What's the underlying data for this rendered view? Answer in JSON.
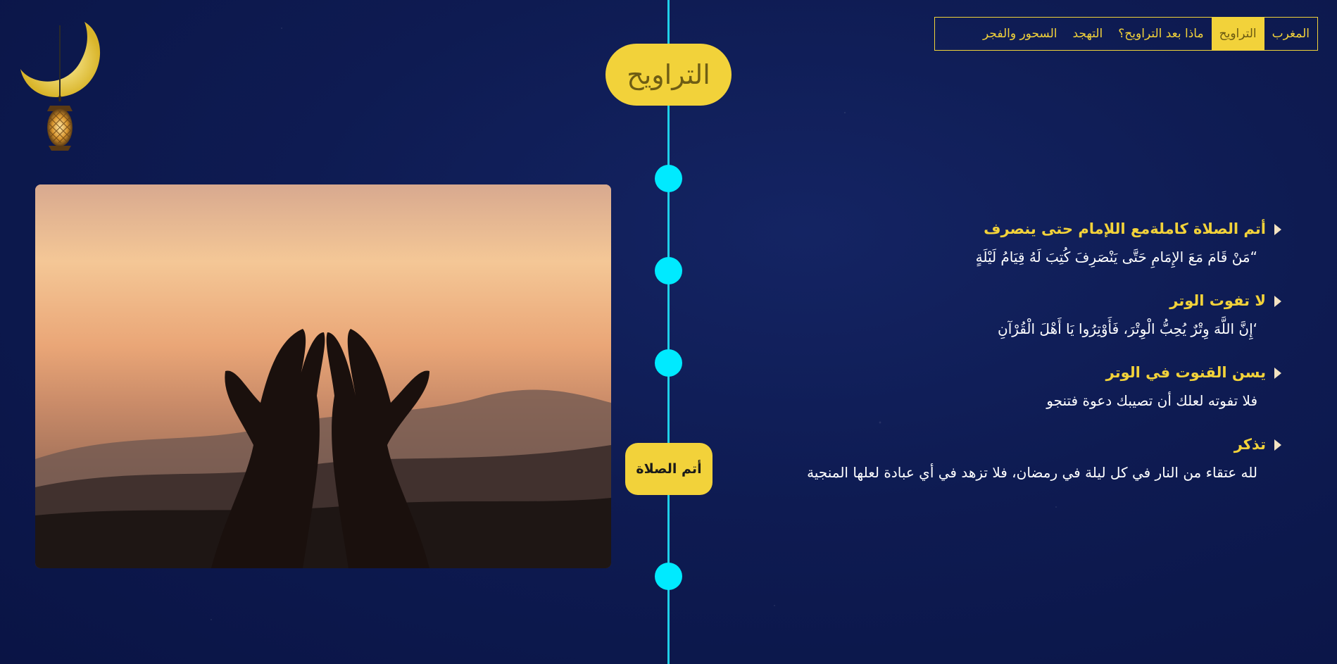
{
  "nav": {
    "items": [
      {
        "label": "المغرب",
        "active": false
      },
      {
        "label": "التراويح",
        "active": true
      },
      {
        "label": "ماذا بعد التراويح؟",
        "active": false
      },
      {
        "label": "التهجد",
        "active": false
      },
      {
        "label": "السحور والفجر",
        "active": false
      }
    ]
  },
  "timeline": {
    "title": "التراويح",
    "label": "أتم الصلاة"
  },
  "content": {
    "items": [
      {
        "title": "أتم الصلاة كاملةمع اللإمام حتى ينصرف",
        "body": "“مَنْ قَامَ مَعَ الإِمَامِ حَتَّى يَنْصَرِفَ كُتِبَ لَهُ قِيَامُ لَيْلَةٍ"
      },
      {
        "title": "لا تفوت الوتر",
        "body": "‘إِنَّ اللَّهَ وِتْرٌ يُحِبُّ الْوِتْرَ، فَأَوْتِرُوا يَا أَهْلَ الْقُرْآنِ"
      },
      {
        "title": "يسن القنوت في الوتر",
        "body": "فلا تفوته لعلك أن تصيبك دعوة فتنجو"
      },
      {
        "title": "تذكر",
        "body": "لله عتقاء من النار في كل ليلة في رمضان، فلا تزهد في أي عبادة لعلها المنجية"
      }
    ]
  },
  "icons": {
    "lantern": "crescent-lantern-icon",
    "marker": "triangle-marker-icon"
  },
  "colors": {
    "background": "#0e1b52",
    "accent": "#f2d23a",
    "timeline": "#00eaff"
  }
}
